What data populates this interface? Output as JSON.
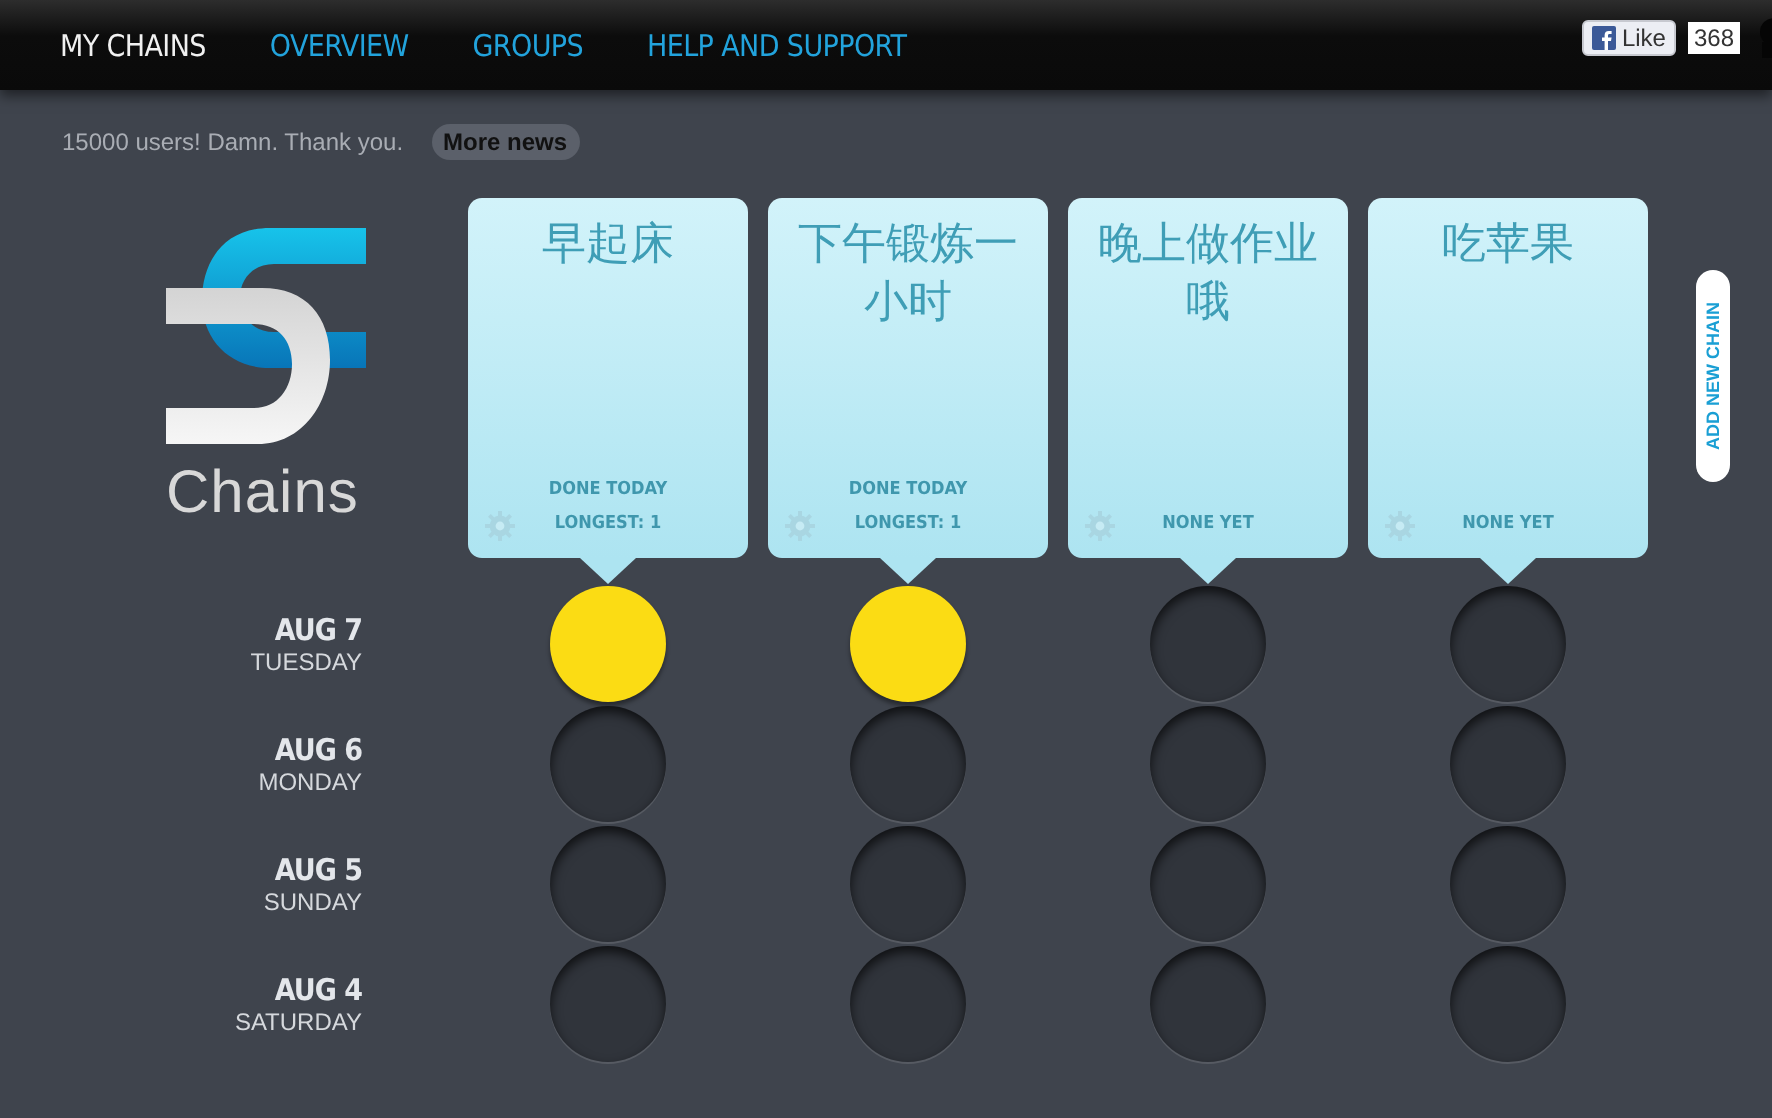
{
  "nav": [
    {
      "label": "MY CHAINS",
      "selected": true
    },
    {
      "label": "OVERVIEW",
      "selected": false
    },
    {
      "label": "GROUPS",
      "selected": false
    },
    {
      "label": "HELP AND SUPPORT",
      "selected": false
    }
  ],
  "like": {
    "label": "Like",
    "count": "368"
  },
  "news": {
    "text": "15000 users! Damn. Thank you.",
    "button": "More news"
  },
  "logo": {
    "text": "Chains"
  },
  "chains": [
    {
      "title": "早起床",
      "status": [
        "DONE TODAY",
        "LONGEST: 1"
      ]
    },
    {
      "title": "下午锻炼一小时",
      "status": [
        "DONE TODAY",
        "LONGEST: 1"
      ]
    },
    {
      "title": "晚上做作业哦",
      "status": [
        "NONE YET"
      ]
    },
    {
      "title": "吃苹果",
      "status": [
        "NONE YET"
      ]
    }
  ],
  "add_button": "ADD NEW CHAIN",
  "days": [
    {
      "date": "AUG 7",
      "weekday": "TUESDAY",
      "cells": [
        {
          "done": true
        },
        {
          "done": true
        },
        {
          "done": false
        },
        {
          "done": false
        }
      ]
    },
    {
      "date": "AUG 6",
      "weekday": "MONDAY",
      "cells": [
        {
          "done": false
        },
        {
          "done": false
        },
        {
          "done": false
        },
        {
          "done": false
        }
      ]
    },
    {
      "date": "AUG 5",
      "weekday": "SUNDAY",
      "cells": [
        {
          "done": false
        },
        {
          "done": false
        },
        {
          "done": false
        },
        {
          "done": false
        }
      ]
    },
    {
      "date": "AUG 4",
      "weekday": "SATURDAY",
      "cells": [
        {
          "done": false
        },
        {
          "done": false
        },
        {
          "done": false
        },
        {
          "done": false
        }
      ]
    }
  ]
}
